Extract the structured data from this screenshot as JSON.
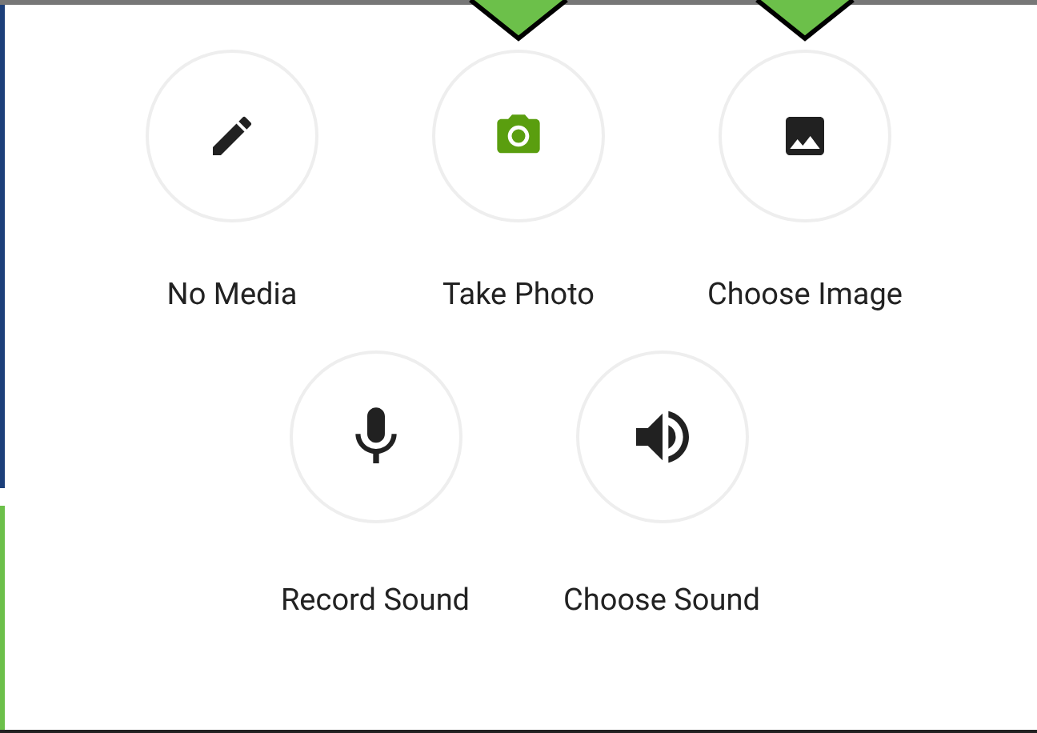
{
  "rows": [
    {
      "items": [
        {
          "kind": "pencil",
          "label": "No Media",
          "color": "#212121",
          "marked": false
        },
        {
          "kind": "camera",
          "label": "Take Photo",
          "color": "#5a9e0f",
          "marked": true
        },
        {
          "kind": "image",
          "label": "Choose Image",
          "color": "#212121",
          "marked": true
        }
      ]
    },
    {
      "items": [
        {
          "kind": "mic",
          "label": "Record Sound",
          "color": "#212121",
          "marked": false
        },
        {
          "kind": "speaker",
          "label": "Choose Sound",
          "color": "#212121",
          "marked": false
        }
      ]
    }
  ]
}
